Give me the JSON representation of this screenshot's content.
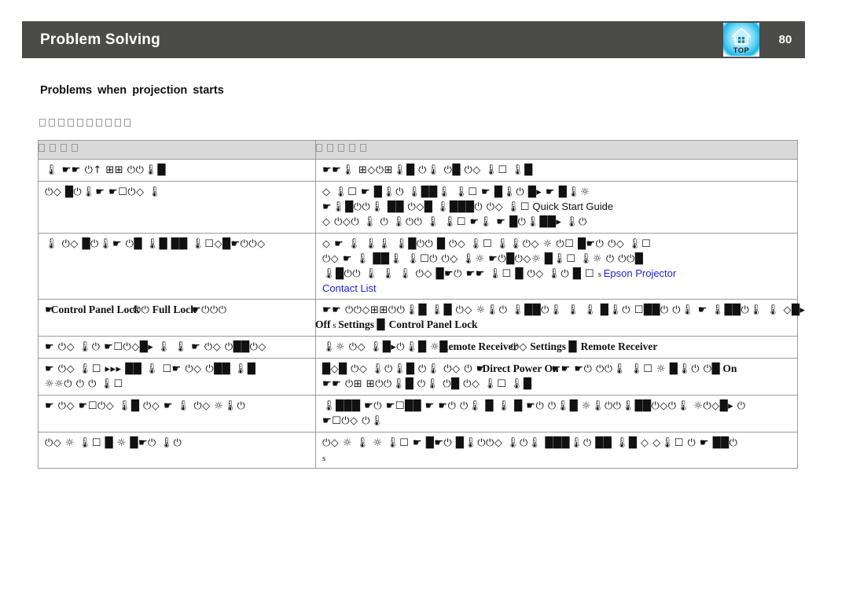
{
  "header": {
    "title": "Problem Solving",
    "page_number": "80",
    "top_button_label": "TOP",
    "top_button_icon": "home-house-icon",
    "bar_color": "#4b4b49",
    "text_color": "#ffffff"
  },
  "section": {
    "heading": "Problems  when  projection  starts",
    "subtitle_boxes": 10,
    "subtitle_note": "missing-glyph boxes"
  },
  "table": {
    "header_bg": "#d9d9d9",
    "border_color": "#9b9b9b",
    "columns": [
      {
        "boxes": 4,
        "label_note": "missing-glyph boxes"
      },
      {
        "boxes": 5,
        "label_note": "missing-glyph boxes"
      }
    ],
    "rows": [
      {
        "left": [
          {
            "sym": "🌡 ☛☛ ⏻↑ ⊞⊞ ⏻⏻🌡█"
          }
        ],
        "right": [
          {
            "sym": "☛☛🌡 ⊞◇⏻⊞🌡█ ⏻🌡 ⏻█ ⏻◇ 🌡☐ 🌡█"
          }
        ]
      },
      {
        "left": [
          {
            "sym": "⏻◇ █⏻🌡☛ ☛☐⏻◇ 🌡"
          }
        ],
        "right": [
          {
            "sym": "◇ 🌡☐ ☛ █🌡⏻ 🌡██🌡 🌡☐ ☛ █🌡⏻ █▸ ☛ █🌡☼"
          },
          {
            "sym": "☛🌡█⏻⏻🌡 ██ ⏻◇█ 🌡███⏻ ⏻◇ ",
            "text": "Quick Start Guide",
            "text_style": "sans-n",
            "text_prefix_sym": "🌡☐"
          },
          {
            "sym": "◇ ⏻◇⏻ 🌡 ⏻ 🌡⏻⏻ 🌡 🌡☐ ☛🌡 ☛ █⏻🌡██▸ 🌡⏻"
          }
        ]
      },
      {
        "left": [
          {
            "sym": "🌡 ⏻◇ █⏻🌡☛ ⏻█ 🌡█ ██ 🌡☐◇█☛⏻⏻◇"
          }
        ],
        "right": [
          {
            "sym": "◇ ☛ 🌡 🌡🌡 🌡█⏻⏻ █ ⏻◇ 🌡☐ 🌡🌡⏻◇ ☼ ⏻☐ █☛⏻ ⏻◇ 🌡☐"
          },
          {
            "sym": "⏻◇ ☛ 🌡 ██🌡 🌡☐⏻ ⏻◇ 🌡☼ ☛⏻█⏻◇☼ █🌡☐ 🌡☼ ⏻ ⏻⏻█"
          },
          {
            "sym": "🌡█⏻⏻ 🌡 🌡 🌡 ⏻◇ █☛⏻ ☛☛ 🌡☐ █ ⏻◇ 🌡⏻ █ ☐ ",
            "text_small": "s",
            "text": "Epson Projector",
            "text_style": "link-blue"
          },
          {
            "text": "Contact List",
            "text_style": "link-blue"
          }
        ]
      },
      {
        "left": [
          {
            "sym": "☛ ",
            "bold_serif": "Control Panel Lock",
            "overlap_sym": "⏻⏻",
            "bold_serif2": "Full Lock",
            "overlap_sym2": "☛⏻⏻⏻"
          }
        ],
        "right": [
          {
            "sym": "☛☛ ⏻⏻◇⊞⊞⏻⏻🌡█ 🌡█ ⏻◇ ☼🌡⏻ 🌡██⏻🌡 🌡 🌡 █🌡⏻ ☐██⏻ ⏻🌡 ☛ 🌡██⏻🌡 🌡 ◇█▸"
          },
          {
            "bold_serif": "Off",
            "text_small": "s",
            "bold_serif2": "Settings",
            "mid_sym": "█",
            "bold_serif3": "Control Panel Lock"
          }
        ]
      },
      {
        "left": [
          {
            "sym": "☛ ⏻◇ 🌡⏻ ☛☐⏻◇█▸ 🌡 🌡 ☛ ⏻◇ ⏻██⏻◇"
          }
        ],
        "right": [
          {
            "bold_serif": "Remote Receiver",
            "overlap_sym": "⏻◇",
            "sym": " 🌡☼ ⏻◇ 🌡█▸⏻🌡█ ☼█",
            "bold_serif2": "Settings",
            "mid_sym": "█",
            "bold_serif3": "Remote Receiver"
          }
        ]
      },
      {
        "left": [
          {
            "sym": "☛ ⏻◇ 🌡☐ ▸▸▸ ██ 🌡 ☐☛ ⏻◇ ⏻██ 🌡█"
          },
          {
            "sym": "☼☼⏻ ⏻ ⏻ 🌡☐"
          }
        ],
        "right": [
          {
            "sym": "█◇█ ⏻◇ 🌡⏻🌡█ ⏻🌡 ⏻◇ ⏻ ☛ ",
            "bold_serif": "Direct Power On",
            "overlap_sym2": "☛☛",
            "sym2": " ☛⏻ ⏻⏻🌡 🌡☐ ☼ █🌡⏻ ⏻█",
            "bold_on": "On"
          },
          {
            "sym": "☛☛ ⏻⊞ ⊞⏻⏻🌡█ ⏻🌡 ⏻█ ⏻◇ 🌡☐ 🌡█"
          }
        ]
      },
      {
        "left": [
          {
            "sym": "☛ ⏻◇ ☛☐⏻◇ 🌡█ ⏻◇ ☛ 🌡 ⏻◇ ☼🌡⏻"
          }
        ],
        "right": [
          {
            "sym": "🌡███ ☛⏻ ☛☐██ ☛ ☛⏻ ⏻🌡 █ 🌡 █ ☛⏻ ⏻🌡█ ☼🌡⏻⏻🌡██⏻◇⏻🌡 ☼⏻◇█▸ ⏻"
          },
          {
            "sym": "☛☐⏻◇ ⏻🌡"
          }
        ]
      },
      {
        "left": [
          {
            "sym": "⏻◇ ☼ 🌡☐ █ ☼ █☛⏻ 🌡⏻"
          }
        ],
        "right": [
          {
            "sym": "⏻◇ ☼ 🌡 ☼ 🌡☐ ☛ █☛⏻ █🌡⏻⏻◇ 🌡⏻🌡 ███🌡⏻ ██ 🌡█ ◇ ◇🌡☐ ⏻ ☛ ██⏻"
          },
          {
            "text_small_only": "s"
          }
        ]
      }
    ]
  }
}
